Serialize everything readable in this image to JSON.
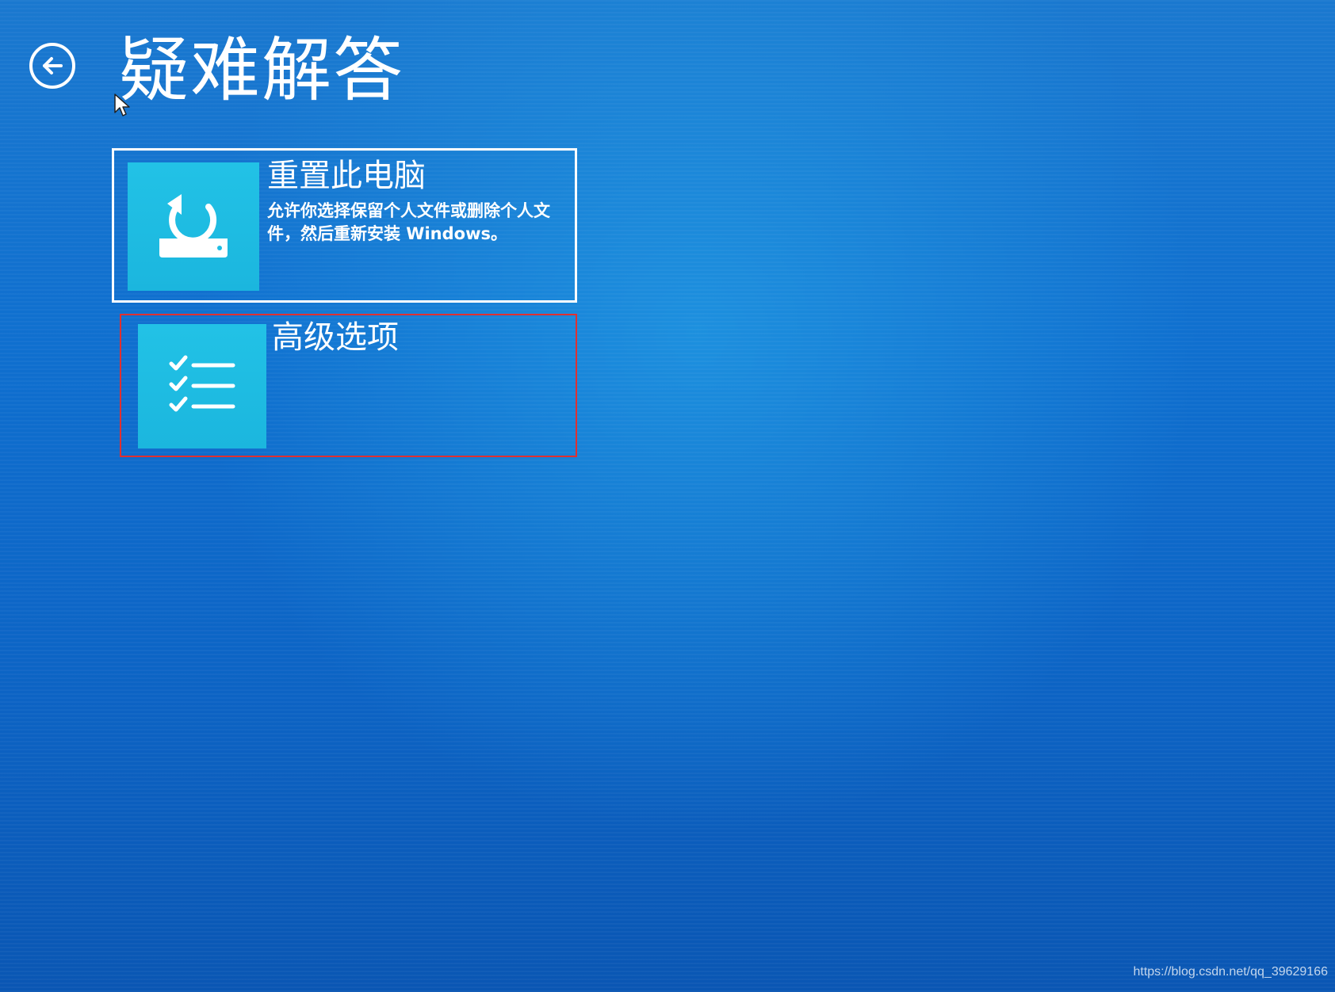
{
  "header": {
    "back_icon": "arrow-left-circle-icon",
    "title": "疑难解答"
  },
  "options": [
    {
      "icon": "reset-pc-icon",
      "title": "重置此电脑",
      "description": "允许你选择保留个人文件或删除个人文件，然后重新安装 Windows。",
      "highlighted": false
    },
    {
      "icon": "checklist-icon",
      "title": "高级选项",
      "highlighted": true,
      "highlight_color": "#e03030"
    }
  ],
  "watermark": "https://blog.csdn.net/qq_39629166",
  "colors": {
    "background": "#0f6fcf",
    "tile": "#1fbde3",
    "text": "#ffffff"
  }
}
